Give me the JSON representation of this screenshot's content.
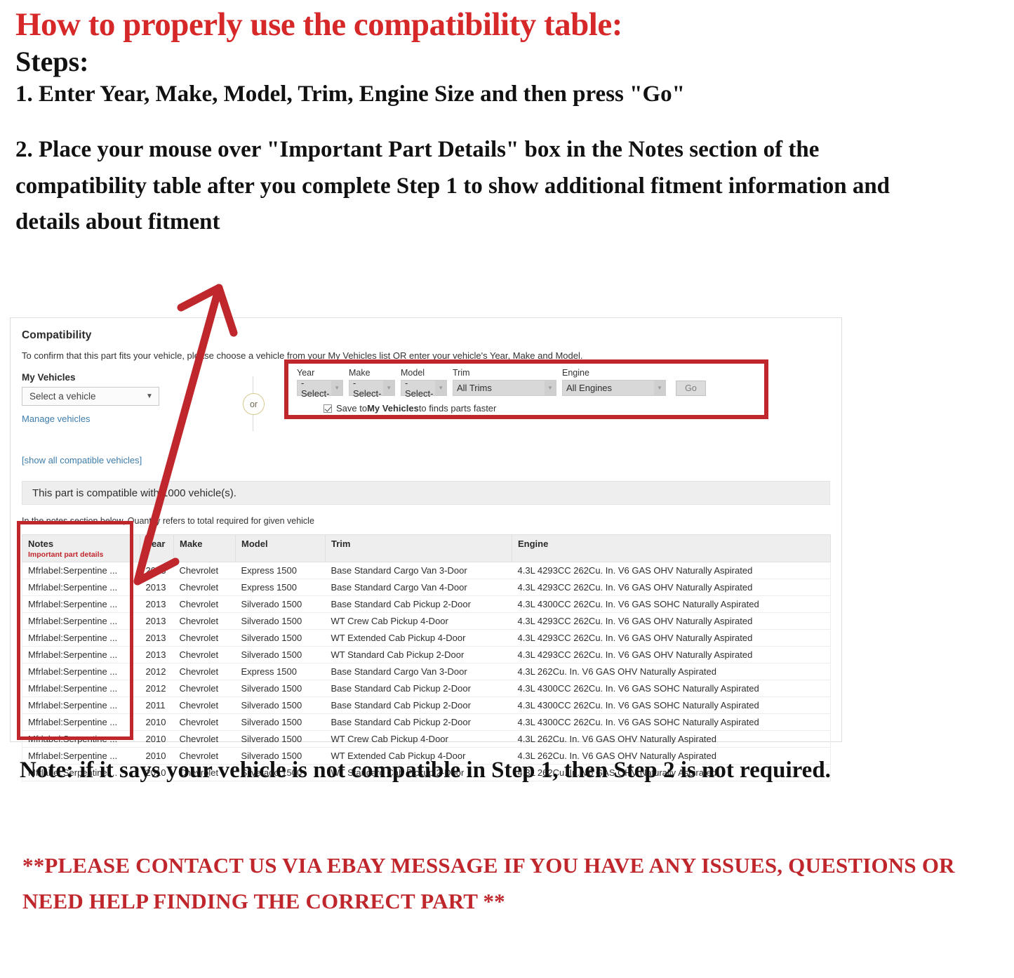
{
  "instructions": {
    "title": "How to properly use the compatibility table:",
    "steps_label": "Steps:",
    "step1": "1. Enter Year, Make, Model, Trim, Engine Size and then press \"Go\"",
    "step2": "2. Place your mouse over \"Important Part Details\" box in the Notes section of the compatibility table after you complete Step 1 to show additional fitment information and details about fitment",
    "note": "Note: if it says your vehicle is not compatible in Step 1, then Step 2 is not required.",
    "contact": "**PLEASE CONTACT US VIA EBAY MESSAGE IF YOU HAVE ANY ISSUES, QUESTIONS OR NEED HELP FINDING THE CORRECT PART **"
  },
  "colors": {
    "red_accent": "#c0272d",
    "title_red": "#d62828",
    "link_blue": "#3e7caa",
    "header_grey": "#eeeeee"
  },
  "panel": {
    "title": "Compatibility",
    "subtitle": "To confirm that this part fits your vehicle, please choose a vehicle from your My Vehicles list OR enter your vehicle's Year, Make and Model.",
    "my_vehicles": {
      "label": "My Vehicles",
      "select_value": "Select a vehicle",
      "manage_link": "Manage vehicles"
    },
    "or_label": "or",
    "selector": {
      "fields": [
        {
          "label": "Year",
          "value": "-Select-"
        },
        {
          "label": "Make",
          "value": "-Select-"
        },
        {
          "label": "Model",
          "value": "-Select-"
        },
        {
          "label": "Trim",
          "value": "All Trims"
        },
        {
          "label": "Engine",
          "value": "All Engines"
        }
      ],
      "go_label": "Go",
      "save_checked": true,
      "save_text_pre": "Save to ",
      "save_text_bold": "My Vehicles",
      "save_text_post": " to finds parts faster"
    },
    "show_all_link": "[show all compatible vehicles]",
    "compat_count_text": "This part is compatible with 1000 vehicle(s).",
    "notes_hint": "In the notes section below, Quantity refers to total required for given vehicle"
  },
  "table": {
    "headers": {
      "notes": "Notes",
      "notes_sub": "Important part details",
      "year": "Year",
      "make": "Make",
      "model": "Model",
      "trim": "Trim",
      "engine": "Engine"
    },
    "rows": [
      {
        "notes": "Mfrlabel:Serpentine ...",
        "year": "2013",
        "make": "Chevrolet",
        "model": "Express 1500",
        "trim": "Base Standard Cargo Van 3-Door",
        "engine": "4.3L 4293CC 262Cu. In. V6 GAS OHV Naturally Aspirated"
      },
      {
        "notes": "Mfrlabel:Serpentine ...",
        "year": "2013",
        "make": "Chevrolet",
        "model": "Express 1500",
        "trim": "Base Standard Cargo Van 4-Door",
        "engine": "4.3L 4293CC 262Cu. In. V6 GAS OHV Naturally Aspirated"
      },
      {
        "notes": "Mfrlabel:Serpentine ...",
        "year": "2013",
        "make": "Chevrolet",
        "model": "Silverado 1500",
        "trim": "Base Standard Cab Pickup 2-Door",
        "engine": "4.3L 4300CC 262Cu. In. V6 GAS SOHC Naturally Aspirated"
      },
      {
        "notes": "Mfrlabel:Serpentine ...",
        "year": "2013",
        "make": "Chevrolet",
        "model": "Silverado 1500",
        "trim": "WT Crew Cab Pickup 4-Door",
        "engine": "4.3L 4293CC 262Cu. In. V6 GAS OHV Naturally Aspirated"
      },
      {
        "notes": "Mfrlabel:Serpentine ...",
        "year": "2013",
        "make": "Chevrolet",
        "model": "Silverado 1500",
        "trim": "WT Extended Cab Pickup 4-Door",
        "engine": "4.3L 4293CC 262Cu. In. V6 GAS OHV Naturally Aspirated"
      },
      {
        "notes": "Mfrlabel:Serpentine ...",
        "year": "2013",
        "make": "Chevrolet",
        "model": "Silverado 1500",
        "trim": "WT Standard Cab Pickup 2-Door",
        "engine": "4.3L 4293CC 262Cu. In. V6 GAS OHV Naturally Aspirated"
      },
      {
        "notes": "Mfrlabel:Serpentine ...",
        "year": "2012",
        "make": "Chevrolet",
        "model": "Express 1500",
        "trim": "Base Standard Cargo Van 3-Door",
        "engine": "4.3L 262Cu. In. V6 GAS OHV Naturally Aspirated"
      },
      {
        "notes": "Mfrlabel:Serpentine ...",
        "year": "2012",
        "make": "Chevrolet",
        "model": "Silverado 1500",
        "trim": "Base Standard Cab Pickup 2-Door",
        "engine": "4.3L 4300CC 262Cu. In. V6 GAS SOHC Naturally Aspirated"
      },
      {
        "notes": "Mfrlabel:Serpentine ...",
        "year": "2011",
        "make": "Chevrolet",
        "model": "Silverado 1500",
        "trim": "Base Standard Cab Pickup 2-Door",
        "engine": "4.3L 4300CC 262Cu. In. V6 GAS SOHC Naturally Aspirated"
      },
      {
        "notes": "Mfrlabel:Serpentine ...",
        "year": "2010",
        "make": "Chevrolet",
        "model": "Silverado 1500",
        "trim": "Base Standard Cab Pickup 2-Door",
        "engine": "4.3L 4300CC 262Cu. In. V6 GAS SOHC Naturally Aspirated"
      },
      {
        "notes": "Mfrlabel:Serpentine ...",
        "year": "2010",
        "make": "Chevrolet",
        "model": "Silverado 1500",
        "trim": "WT Crew Cab Pickup 4-Door",
        "engine": "4.3L 262Cu. In. V6 GAS OHV Naturally Aspirated"
      },
      {
        "notes": "Mfrlabel:Serpentine ...",
        "year": "2010",
        "make": "Chevrolet",
        "model": "Silverado 1500",
        "trim": "WT Extended Cab Pickup 4-Door",
        "engine": "4.3L 262Cu. In. V6 GAS OHV Naturally Aspirated"
      },
      {
        "notes": "Mfrlabel:Serpentine ...",
        "year": "2010",
        "make": "Chevrolet",
        "model": "Silverado 1500",
        "trim": "WT Standard Cab Pickup 2-Door",
        "engine": "4.3L 262Cu. In. V6 GAS OHV Naturally Aspirated"
      }
    ]
  }
}
